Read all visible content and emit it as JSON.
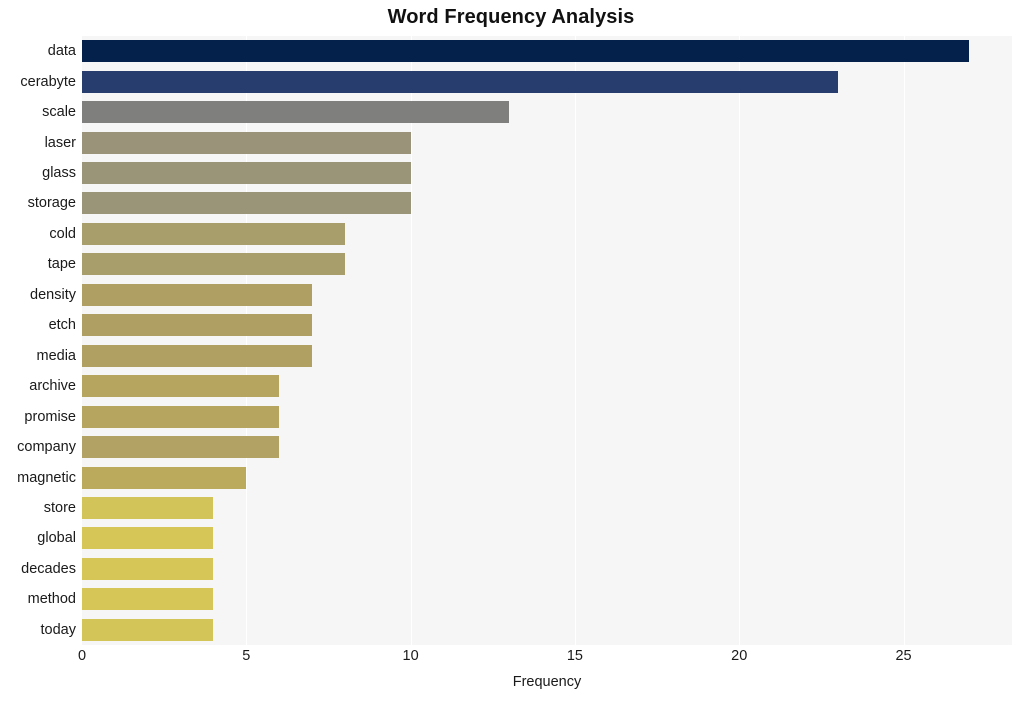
{
  "chart_data": {
    "type": "bar",
    "orientation": "horizontal",
    "title": "Word Frequency Analysis",
    "xlabel": "Frequency",
    "ylabel": "",
    "categories": [
      "data",
      "cerabyte",
      "scale",
      "laser",
      "glass",
      "storage",
      "cold",
      "tape",
      "density",
      "etch",
      "media",
      "archive",
      "promise",
      "company",
      "magnetic",
      "store",
      "global",
      "decades",
      "method",
      "today"
    ],
    "values": [
      27,
      23,
      13,
      10,
      10,
      10,
      8,
      8,
      7,
      7,
      7,
      6,
      6,
      6,
      5,
      4,
      4,
      4,
      4,
      4
    ],
    "bar_colors": [
      "#03214b",
      "#263d6e",
      "#7f807d",
      "#9a937a",
      "#9a9479",
      "#9a9578",
      "#a89e6c",
      "#a89e6c",
      "#af9f63",
      "#af9f63",
      "#b0a163",
      "#b5a55f",
      "#b5a55f",
      "#b2a263",
      "#bba95c",
      "#d2c459",
      "#d5c657",
      "#d5c657",
      "#d5c657",
      "#d4c558"
    ],
    "xlim": [
      0,
      28.3
    ],
    "xticks": [
      0,
      5,
      10,
      15,
      20,
      25
    ],
    "xtick_labels": [
      "0",
      "5",
      "10",
      "15",
      "20",
      "25"
    ],
    "grid": "vertical",
    "legend": "none",
    "plot_background": "#f6f6f6",
    "figure_background": "#ffffff"
  }
}
